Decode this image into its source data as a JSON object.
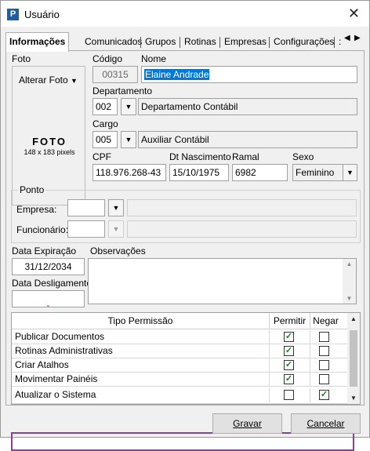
{
  "window": {
    "title": "Usuário",
    "app_icon_letter": "P",
    "close_glyph": "✕"
  },
  "tabs": [
    "Informações",
    "Comunicados",
    "Grupos",
    "Rotinas",
    "Empresas",
    "Configurações",
    ":"
  ],
  "photo": {
    "label": "Foto",
    "change_button": "Alterar Foto",
    "placeholder_title": "FOTO",
    "placeholder_size": "148 x 183 pixels"
  },
  "fields": {
    "codigo_label": "Código",
    "codigo_value": "00315",
    "nome_label": "Nome",
    "nome_value": "Elaine Andrade",
    "departamento_label": "Departamento",
    "departamento_code": "002",
    "departamento_name": "Departamento Contábil",
    "cargo_label": "Cargo",
    "cargo_code": "005",
    "cargo_name": "Auxiliar Contábil",
    "cpf_label": "CPF",
    "cpf_value": "118.976.268-43",
    "nasc_label": "Dt Nascimento",
    "nasc_value": "15/10/1975",
    "ramal_label": "Ramal",
    "ramal_value": "6982",
    "sexo_label": "Sexo",
    "sexo_value": "Feminino"
  },
  "ponto": {
    "title": "Ponto",
    "empresa_label": "Empresa:",
    "funcionario_label": "Funcionário:"
  },
  "dates": {
    "expiracao_label": "Data Expiração",
    "expiracao_value": "31/12/2034",
    "desligamento_label": "Data Desligamento",
    "desligamento_value": ""
  },
  "observacoes_label": "Observações",
  "permissions": {
    "col_tipo": "Tipo Permissão",
    "col_permitir": "Permitir",
    "col_negar": "Negar",
    "rows": [
      {
        "name": "Publicar Documentos",
        "permitir": true,
        "negar": false
      },
      {
        "name": "Rotinas Administrativas",
        "permitir": true,
        "negar": false
      },
      {
        "name": "Criar Atalhos",
        "permitir": true,
        "negar": false
      },
      {
        "name": "Movimentar Painéis",
        "permitir": true,
        "negar": false
      },
      {
        "name": "Atualizar o Sistema",
        "permitir": false,
        "negar": true
      }
    ],
    "highlight_color": "#8b3fa0"
  },
  "buttons": {
    "save": "Gravar",
    "cancel": "Cancelar"
  }
}
